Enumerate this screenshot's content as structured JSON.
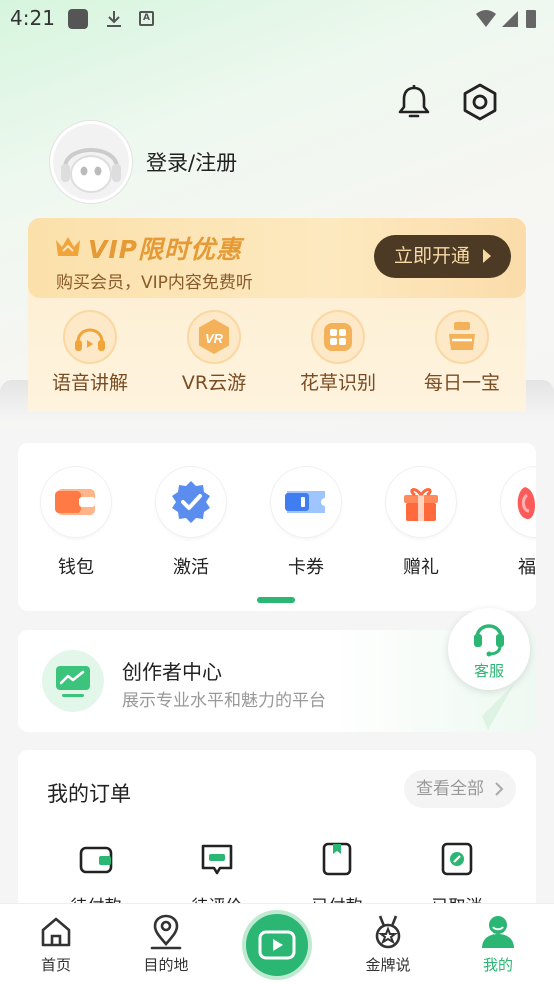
{
  "status_bar": {
    "time": "4:21"
  },
  "header": {
    "login_text": "登录/注册"
  },
  "vip": {
    "title": "VIP限时优惠",
    "subtitle": "购买会员，VIP内容免费听",
    "button_label": "立即开通",
    "features": [
      {
        "label": "语音讲解",
        "icon": "headphones-icon"
      },
      {
        "label": "VR云游",
        "icon": "vr-icon"
      },
      {
        "label": "花草识别",
        "icon": "flower-grid-icon"
      },
      {
        "label": "每日一宝",
        "icon": "treasure-icon"
      }
    ]
  },
  "quick": {
    "items": [
      {
        "label": "钱包",
        "icon": "wallet-icon"
      },
      {
        "label": "激活",
        "icon": "activate-badge-icon"
      },
      {
        "label": "卡券",
        "icon": "coupon-icon"
      },
      {
        "label": "赠礼",
        "icon": "gift-icon"
      },
      {
        "label": "福利",
        "icon": "welfare-icon"
      }
    ]
  },
  "creator": {
    "title": "创作者中心",
    "subtitle": "展示专业水平和魅力的平台"
  },
  "kefu": {
    "label": "客服"
  },
  "orders": {
    "title": "我的订单",
    "view_all": "查看全部",
    "items": [
      {
        "label": "待付款",
        "icon": "wallet-outline-icon"
      },
      {
        "label": "待评价",
        "icon": "comment-icon"
      },
      {
        "label": "已付款",
        "icon": "bookmark-icon"
      },
      {
        "label": "已取消",
        "icon": "cancel-icon"
      }
    ]
  },
  "nav": {
    "items": [
      {
        "label": "首页",
        "icon": "home-icon"
      },
      {
        "label": "目的地",
        "icon": "location-icon"
      },
      {
        "label": "金牌说",
        "icon": "medal-icon"
      },
      {
        "label": "我的",
        "icon": "user-icon"
      }
    ],
    "active_color": "#2bb673"
  },
  "colors": {
    "accent": "#2bb673",
    "vip_gold": "#e59a35",
    "vip_button": "#4c3a24"
  }
}
